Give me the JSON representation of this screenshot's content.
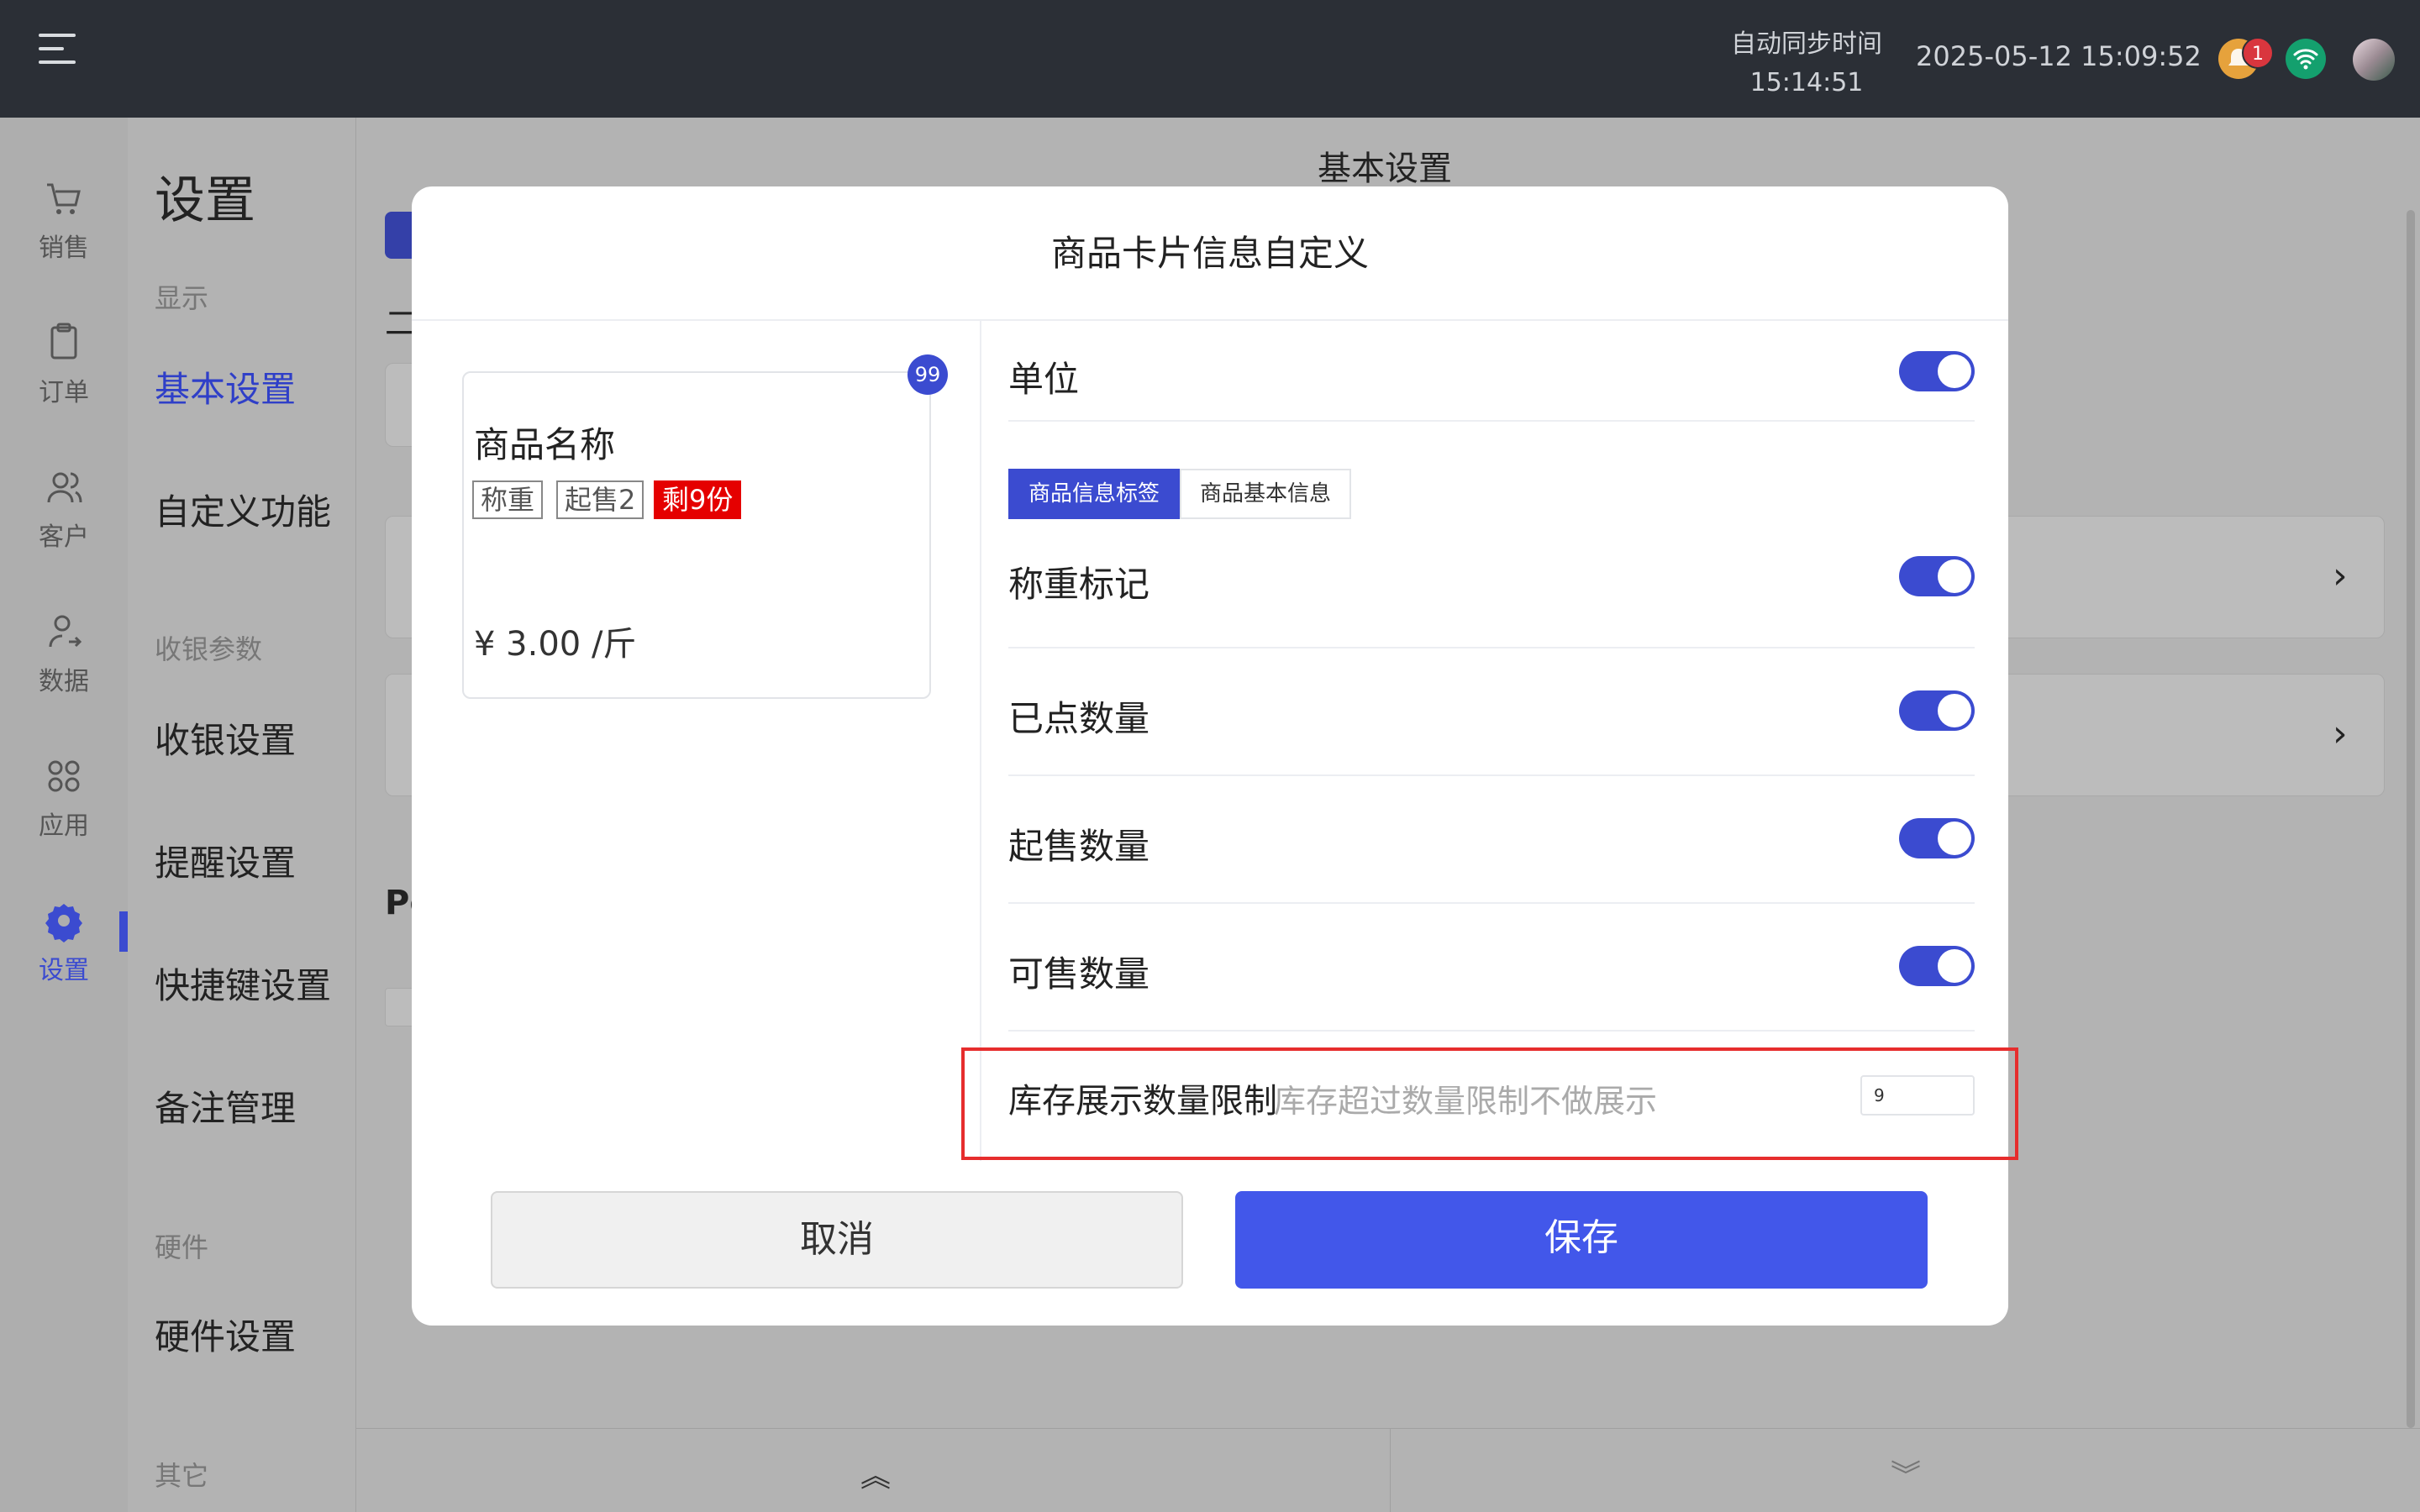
{
  "topbar": {
    "sync_label": "自动同步时间",
    "sync_time": "15:14:51",
    "datetime": "2025-05-12 15:09:52",
    "notification_count": "1"
  },
  "nav": {
    "items": [
      {
        "label": "销售",
        "icon": "cart-icon"
      },
      {
        "label": "订单",
        "icon": "clipboard-icon"
      },
      {
        "label": "客户",
        "icon": "users-icon"
      },
      {
        "label": "数据",
        "icon": "user-arrow-icon"
      },
      {
        "label": "应用",
        "icon": "apps-icon"
      },
      {
        "label": "设置",
        "icon": "gear-icon"
      }
    ],
    "active_color": "#3b4bd0"
  },
  "subnav": {
    "title": "设置",
    "group_display": "显示",
    "item_basic": "基本设置",
    "item_custom": "自定义功能",
    "group_cashier": "收银参数",
    "item_cashier": "收银设置",
    "item_reminder": "提醒设置",
    "item_shortcut": "快捷键设置",
    "item_notes": "备注管理",
    "group_hardware": "硬件",
    "item_hardware": "硬件设置",
    "group_other": "其它"
  },
  "main": {
    "title": "基本设置",
    "partial_text_1": "二",
    "partial_text_2": "Pc"
  },
  "modal": {
    "title": "商品卡片信息自定义",
    "preview": {
      "badge": "99",
      "name": "商品名称",
      "tags": [
        "称重",
        "起售2",
        "剩9份"
      ],
      "price": "¥ 3.00 /斤"
    },
    "tabs": [
      "商品信息标签",
      "商品基本信息"
    ],
    "unit_label": "单位",
    "settings": [
      {
        "label": "称重标记",
        "enabled": true
      },
      {
        "label": "已点数量",
        "enabled": true
      },
      {
        "label": "起售数量",
        "enabled": true
      },
      {
        "label": "可售数量",
        "enabled": true
      }
    ],
    "limit": {
      "label": "库存展示数量限制",
      "hint": "库存超过数量限制不做展示",
      "value": "9"
    },
    "cancel_label": "取消",
    "save_label": "保存"
  },
  "colors": {
    "primary": "#4257ea",
    "highlight": "#e62d2d",
    "tag_red": "#e50000"
  }
}
